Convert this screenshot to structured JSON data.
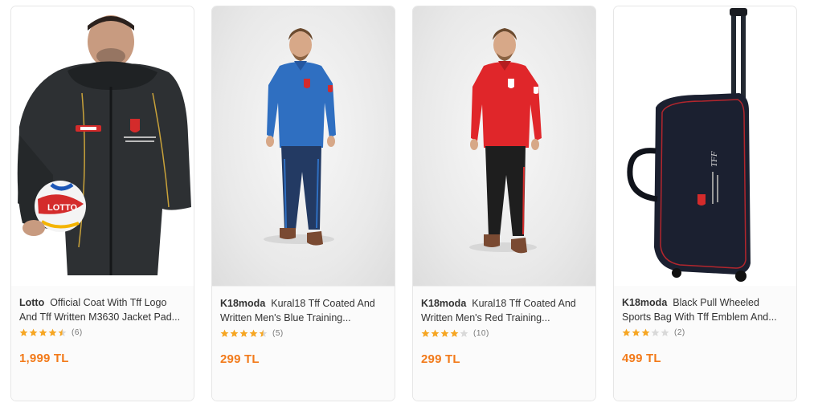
{
  "accent_color": "#f27a1a",
  "star_color": "#f6a623",
  "products": [
    {
      "brand": "Lotto",
      "name": "Official Coat With Tff Logo And Tff Written M3630 Jacket Pad...",
      "rating": 4.5,
      "review_count": "(6)",
      "price": "1,999 TL",
      "image_alt": "black padded coat with tff logo held with football"
    },
    {
      "brand": "K18moda",
      "name": "Kural18 Tff Coated And Written Men's Blue Training...",
      "rating": 4.5,
      "review_count": "(5)",
      "price": "299 TL",
      "image_alt": "man in blue training tracksuit"
    },
    {
      "brand": "K18moda",
      "name": "Kural18 Tff Coated And Written Men's Red Training...",
      "rating": 4,
      "review_count": "(10)",
      "price": "299 TL",
      "image_alt": "man in red training top"
    },
    {
      "brand": "K18moda",
      "name": "Black Pull Wheeled Sports Bag With Tff Emblem And...",
      "rating": 3,
      "review_count": "(2)",
      "price": "499 TL",
      "image_alt": "black wheeled trolley sports bag"
    }
  ]
}
